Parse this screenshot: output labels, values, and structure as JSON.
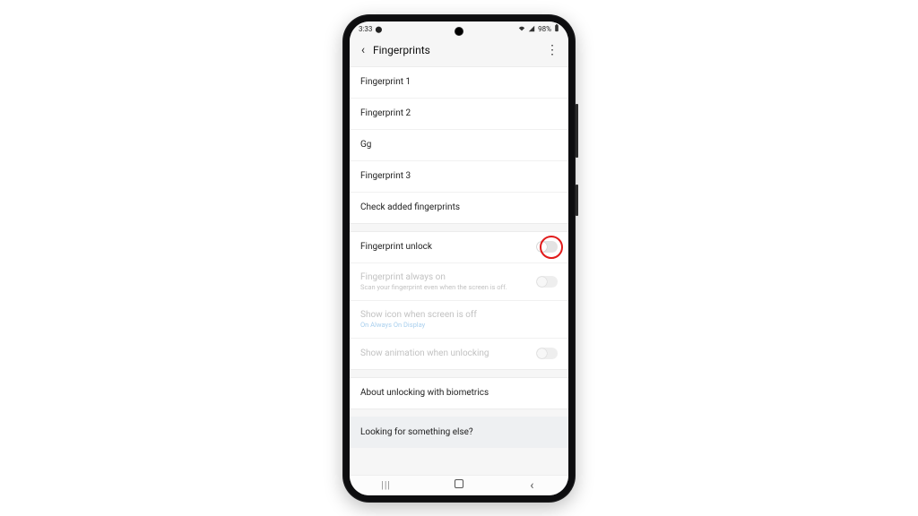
{
  "status": {
    "time": "3:33",
    "rec_icon": "▢",
    "wifi_icon": "▾",
    "signal_icon": "▴",
    "battery_text": "98%",
    "battery_icon": "▮"
  },
  "header": {
    "back_glyph": "‹",
    "title": "Fingerprints",
    "more_glyph": "⋮"
  },
  "fingerprints": [
    {
      "label": "Fingerprint 1"
    },
    {
      "label": "Fingerprint 2"
    },
    {
      "label": "Gg"
    },
    {
      "label": "Fingerprint 3"
    },
    {
      "label": "Check added fingerprints"
    }
  ],
  "options": {
    "unlock": {
      "label": "Fingerprint unlock",
      "on": false,
      "highlight": true
    },
    "always_on": {
      "label": "Fingerprint always on",
      "sub": "Scan your fingerprint even when the screen is off.",
      "on": false,
      "disabled": true
    },
    "show_icon": {
      "label": "Show icon when screen is off",
      "link": "On Always On Display",
      "disabled": true
    },
    "show_anim": {
      "label": "Show animation when unlocking",
      "on": false,
      "disabled": true
    }
  },
  "about": {
    "label": "About unlocking with biometrics"
  },
  "footer": {
    "label": "Looking for something else?"
  },
  "nav": {
    "recents": "|||",
    "back": "‹"
  }
}
